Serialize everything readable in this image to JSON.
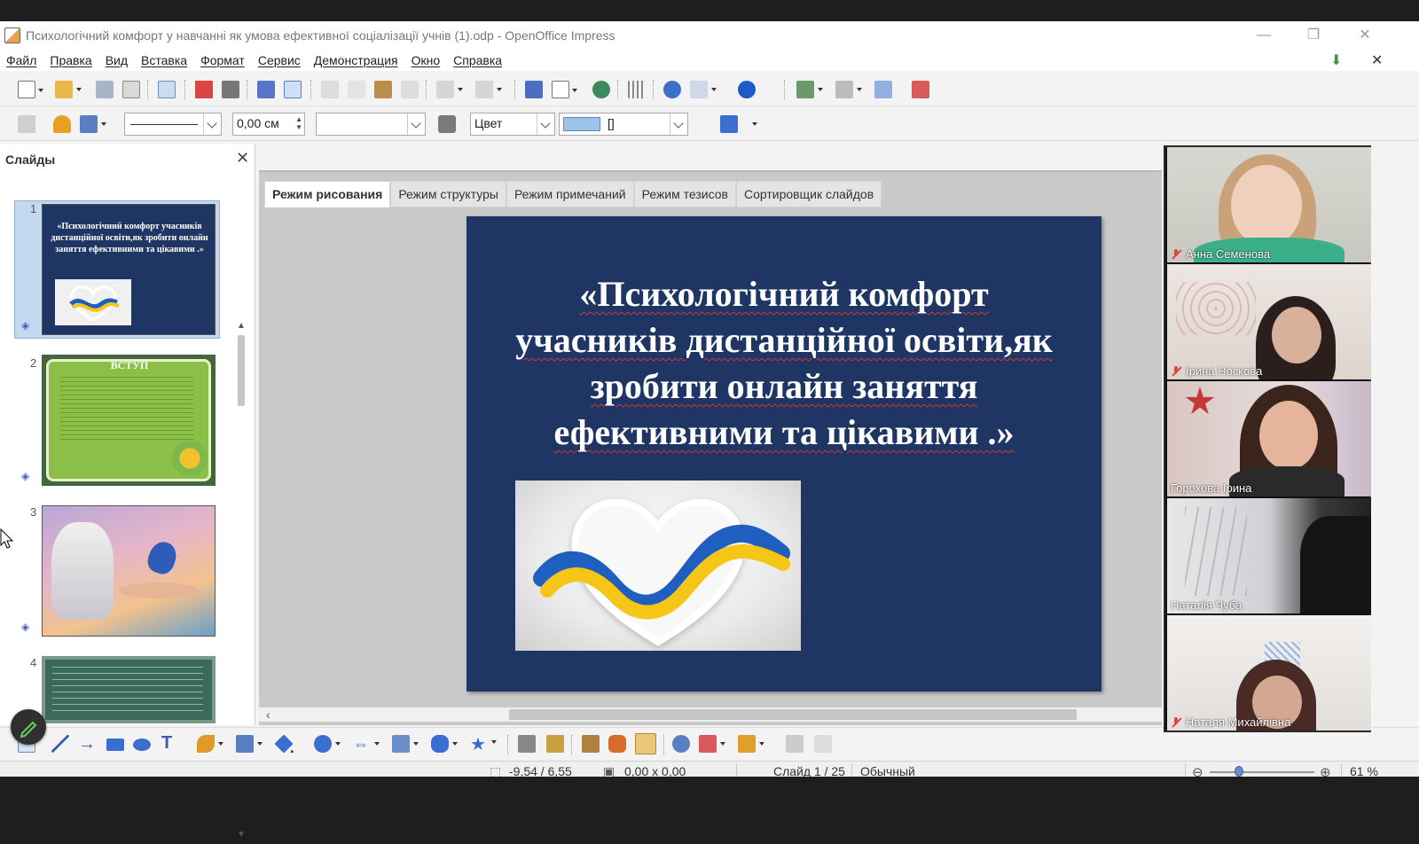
{
  "window": {
    "title": "Психологічний комфорт у навчанні як умова ефективної соціалізації учнів (1).odp - OpenOffice Impress"
  },
  "menu": [
    "Файл",
    "Правка",
    "Вид",
    "Вставка",
    "Формат",
    "Сервис",
    "Демонстрация",
    "Окно",
    "Справка"
  ],
  "toolbar2": {
    "line_width": "0,00 см",
    "fill_type": "Цвет",
    "fill_value": "[]"
  },
  "slides_pane": {
    "title": "Слайды",
    "thumbnails": [
      {
        "number": "1",
        "text": "«Психологічний комфорт учасників дистанційної освіти,як зробити онлайн заняття ефективними та цікавими .»"
      },
      {
        "number": "2",
        "text": "ВСТУП"
      },
      {
        "number": "3",
        "text": ""
      },
      {
        "number": "4",
        "text": ""
      }
    ]
  },
  "view_tabs": [
    "Режим рисования",
    "Режим структуры",
    "Режим примечаний",
    "Режим тезисов",
    "Сортировщик слайдов"
  ],
  "slide": {
    "title_lines": [
      "«Психологічний комфорт",
      "учасників дистанційної освіти,як",
      "зробити онлайн заняття",
      "ефективними та цікавими .»"
    ]
  },
  "status": {
    "position": "-9,54 / 6,55",
    "size": "0,00 x 0,00",
    "slide": "Слайд 1 / 25",
    "layout": "Обычный",
    "zoom": "61 %"
  },
  "participants": [
    {
      "name": "Анна Семенова",
      "muted": true
    },
    {
      "name": "Ірина Носкова",
      "muted": true
    },
    {
      "name": "Горохова Ірина",
      "muted": false
    },
    {
      "name": "Наталія Чуба",
      "muted": false
    },
    {
      "name": "Наталя Михайлівна",
      "muted": true
    }
  ],
  "colors": {
    "slide_bg": "#1f3664",
    "flag_blue": "#1f5fbf",
    "flag_yellow": "#f5c518",
    "mic_off": "#e04545"
  }
}
